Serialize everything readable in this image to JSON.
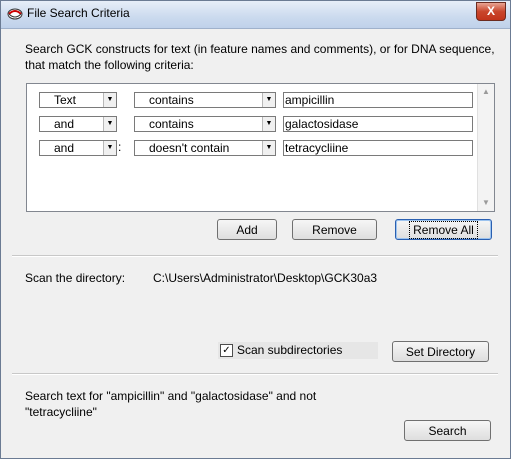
{
  "window": {
    "title": "File Search Criteria",
    "close_label": "X"
  },
  "intro_text": "Search GCK constructs for text (in feature names and comments), or for DNA sequence, that match the following criteria:",
  "criteria": [
    {
      "field": "Text",
      "operator": "contains",
      "value": "ampicillin",
      "separator": ""
    },
    {
      "field": "and",
      "operator": "contains",
      "value": "galactosidase",
      "separator": ""
    },
    {
      "field": "and",
      "operator": "doesn't contain",
      "value": "tetracycliine",
      "separator": ":"
    }
  ],
  "buttons": {
    "add": "Add",
    "remove": "Remove",
    "remove_all": "Remove All",
    "set_directory": "Set Directory",
    "search": "Search"
  },
  "directory": {
    "label": "Scan the directory:",
    "path": "C:\\Users\\Administrator\\Desktop\\GCK30a3"
  },
  "scan_subdirectories": {
    "label": "Scan subdirectories",
    "checked": true,
    "mark": "✓"
  },
  "summary_text": "Search text  for \"ampicillin\" and \"galactosidase\" and not \"tetracycliine\""
}
